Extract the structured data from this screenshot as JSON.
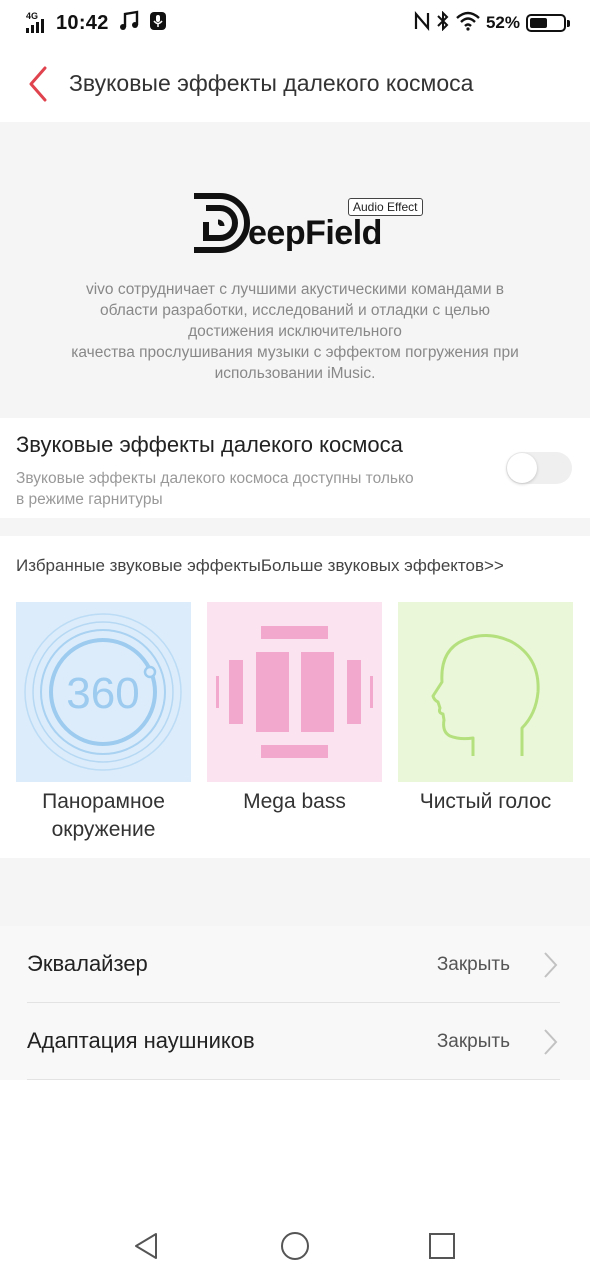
{
  "status_bar": {
    "network": "4G",
    "time": "10:42",
    "battery_percent": "52%",
    "battery_level": 0.52,
    "icons": [
      "signal-icon",
      "music-note-icon",
      "microphone-icon",
      "nfc-icon",
      "bluetooth-icon",
      "wifi-icon",
      "battery-icon"
    ]
  },
  "header": {
    "title": "Звуковые эффекты далекого космоса"
  },
  "intro": {
    "logo_text": "eepField",
    "logo_badge": "Audio Effect",
    "description_lines": [
      "vivo сотрудничает с лучшими акустическими командами в",
      "области разработки, исследований и отладки с целью",
      "достижения исключительного",
      "качества прослушивания музыки с эффектом погружения при",
      "использовании iMusic."
    ]
  },
  "toggle": {
    "title": "Звуковые эффекты далекого космоса",
    "description_lines": [
      "Звуковые эффекты далекого космоса доступны только",
      "в режиме гарнитуры"
    ],
    "enabled": false
  },
  "effects": {
    "favorites_label": "Избранные звуковые эффекты",
    "more_label": "Больше звуковых эффектов>>",
    "tiles": [
      {
        "label_lines": [
          "Панорамное",
          "окружение"
        ],
        "icon": "surround-360-icon",
        "badge": "360",
        "bg": "#dcecfb",
        "color": "#9ccbef"
      },
      {
        "label_lines": [
          "Mega bass"
        ],
        "icon": "mega-bass-icon",
        "bg": "#fbe3f0",
        "color": "#f2a8cc"
      },
      {
        "label_lines": [
          "Чистый голос"
        ],
        "icon": "clear-voice-head-icon",
        "bg": "#eaf7d8",
        "color": "#b5e07e"
      }
    ]
  },
  "settings": [
    {
      "label": "Эквалайзер",
      "value": "Закрыть"
    },
    {
      "label": "Адаптация наушников",
      "value": "Закрыть"
    }
  ],
  "navbar": {
    "icons": [
      "back-triangle-icon",
      "home-circle-icon",
      "recents-square-icon"
    ]
  },
  "colors": {
    "accent": "#e0434e",
    "section_bg": "#f5f5f5"
  }
}
